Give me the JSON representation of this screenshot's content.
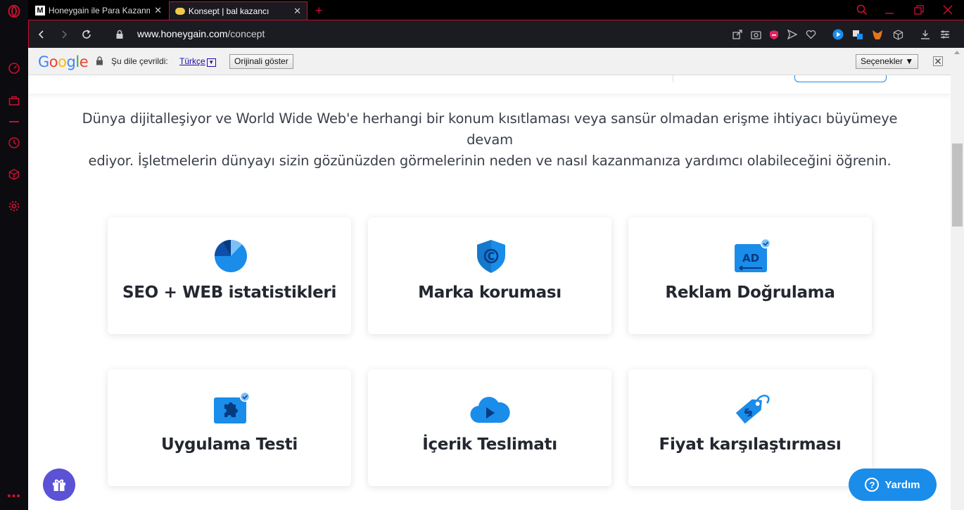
{
  "browser": {
    "tabs": [
      {
        "title": "Honeygain ile Para Kazanm",
        "active": false
      },
      {
        "title": "Konsept | bal kazancı",
        "active": true
      }
    ],
    "new_tab_symbol": "+",
    "url_domain": "www.honeygain.com",
    "url_path": "/concept"
  },
  "translate_bar": {
    "brand": "Google",
    "translated_to_label": "Şu dile çevrildi:",
    "language": "Türkçe",
    "show_original": "Orijinali göster",
    "options": "Seçenekler ▼"
  },
  "page": {
    "intro_line1": "Dünya dijitalleşiyor ve World Wide Web'e herhangi bir konum kısıtlaması veya sansür olmadan erişme ihtiyacı büyümeye devam",
    "intro_line2": "ediyor. İşletmelerin dünyayı sizin gözünüzden görmelerinin neden ve nasıl kazanmanıza yardımcı olabileceğini öğrenin.",
    "cards": [
      {
        "label": "SEO + WEB istatistikleri",
        "icon": "pie-chart-icon"
      },
      {
        "label": "Marka koruması",
        "icon": "copyright-shield-icon"
      },
      {
        "label": "Reklam Doğrulama",
        "icon": "ad-verified-icon"
      },
      {
        "label": "Uygulama Testi",
        "icon": "puzzle-verified-icon"
      },
      {
        "label": "İçerik Teslimatı",
        "icon": "cloud-play-icon"
      },
      {
        "label": "Fiyat karşılaştırması",
        "icon": "price-tag-icon"
      }
    ],
    "help_button": "Yardım"
  },
  "colors": {
    "accent_red": "#c8102e",
    "brand_blue": "#1a8cea",
    "gift_purple": "#5b52d6"
  }
}
